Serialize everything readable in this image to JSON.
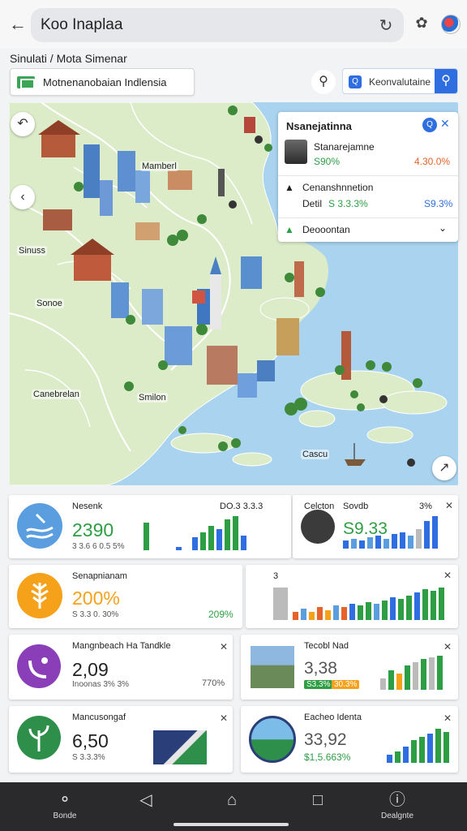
{
  "browser": {
    "address": "Koo Inaplaa",
    "back_icon": "arrow-left-icon",
    "refresh_icon": "refresh-icon",
    "extension_icon": "puzzle-icon",
    "profile_icon": "profile-avatar-icon"
  },
  "page": {
    "subtitle": "Sinulati / Mota Simenar",
    "region_field": "Motnenanobaian Indlensia",
    "map_search": "Keonvalutaine"
  },
  "map": {
    "labels": [
      "Mamberl",
      "Sinuss",
      "Sonoe",
      "Canebrelan",
      "Smilon",
      "Cascu"
    ]
  },
  "info_panel": {
    "title": "Nsanejatinna",
    "row1": {
      "name": "Stanarejamne",
      "left": "S90%",
      "right": "4.30.0%"
    },
    "row2": {
      "name": "Cenanshnnetion",
      "sub": "Detil",
      "left": "S 3.3.3%",
      "right": "S9.3%"
    },
    "row3": {
      "name": "Deooontan"
    }
  },
  "cards": {
    "c1": {
      "title": "Nesenk",
      "value": "2390",
      "sub": "3 3.6 6 0.5 5%",
      "extra": "DO.3 3.3.3"
    },
    "c2": {
      "title": "Celcton",
      "title2": "Sovdb",
      "value": "S9.33",
      "extra": "3%"
    },
    "c3": {
      "title": "Senapnianam",
      "value": "200%",
      "sub": "S 3.3 0. 30%",
      "extra": "209%"
    },
    "c4": {
      "title": "3"
    },
    "c5": {
      "title": "Mangnbeach Ha Tandkle",
      "value": "2,09",
      "sub": "Inoonas 3% 3%",
      "extra": "770%"
    },
    "c6": {
      "title": "Tecobl Nad",
      "value": "3,38",
      "pill1": "S3.3%",
      "pill2": "30.3%"
    },
    "c7": {
      "title": "Mancusongaf",
      "value": "6,50",
      "sub": "S 3.3.3%"
    },
    "c8": {
      "title": "Eacheo Identa",
      "value": "33,92",
      "sub": "$1,5.663%"
    }
  },
  "colors": {
    "accent_blue": "#2f6ee0",
    "green": "#2e9e44",
    "orange": "#e6622a",
    "card_icon_blue": "#5a9ee0",
    "card_icon_orange": "#f5a11a",
    "card_icon_purple": "#8a3fb8",
    "card_icon_green": "#2e8f4a"
  },
  "bottom_nav": {
    "left_label": "Bonde",
    "right_label": "Dealgnte"
  }
}
